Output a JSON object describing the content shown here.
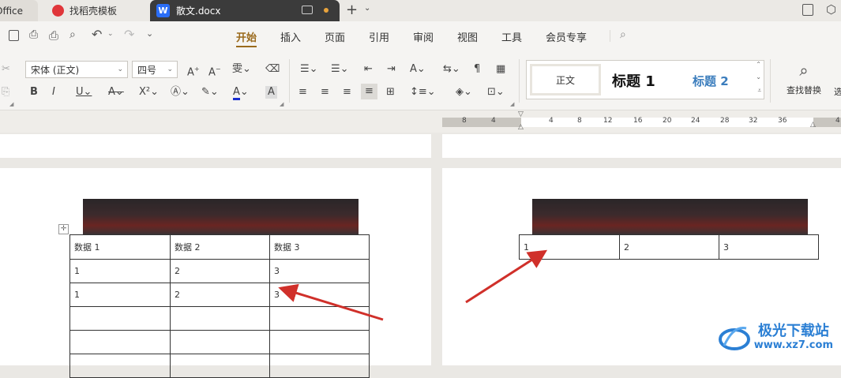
{
  "tabs": {
    "office": "Office",
    "daoke": "找稻壳模板",
    "doc": "散文.docx"
  },
  "menu": {
    "items": [
      "开始",
      "插入",
      "页面",
      "引用",
      "审阅",
      "视图",
      "工具",
      "会员专享"
    ]
  },
  "ribbon": {
    "font_name": "宋体 (正文)",
    "font_size": "四号",
    "find_replace": "查找替换",
    "find_more": "选"
  },
  "styles": {
    "normal": "正文",
    "heading1": "标题 1",
    "heading2": "标题 2"
  },
  "ruler": {
    "left_ticks": [
      "8",
      "4"
    ],
    "right_ticks": [
      "4",
      "8",
      "12",
      "16",
      "20",
      "24",
      "28",
      "32",
      "36",
      "4"
    ]
  },
  "left_table": {
    "header": [
      "数据 1",
      "数据 2",
      "数据 3"
    ],
    "rows": [
      [
        "1",
        "2",
        "3"
      ],
      [
        "1",
        "2",
        "3"
      ],
      [
        "",
        "",
        ""
      ],
      [
        "",
        "",
        ""
      ],
      [
        "",
        "",
        ""
      ]
    ]
  },
  "right_table": {
    "rows": [
      [
        "1",
        "2",
        "3"
      ]
    ]
  },
  "watermark": {
    "title": "极光下载站",
    "url": "www.xz7.com"
  },
  "colors": {
    "accent": "#9a6a1c",
    "arrow": "#d0302a",
    "doc_tab": "#3b3b3b"
  }
}
